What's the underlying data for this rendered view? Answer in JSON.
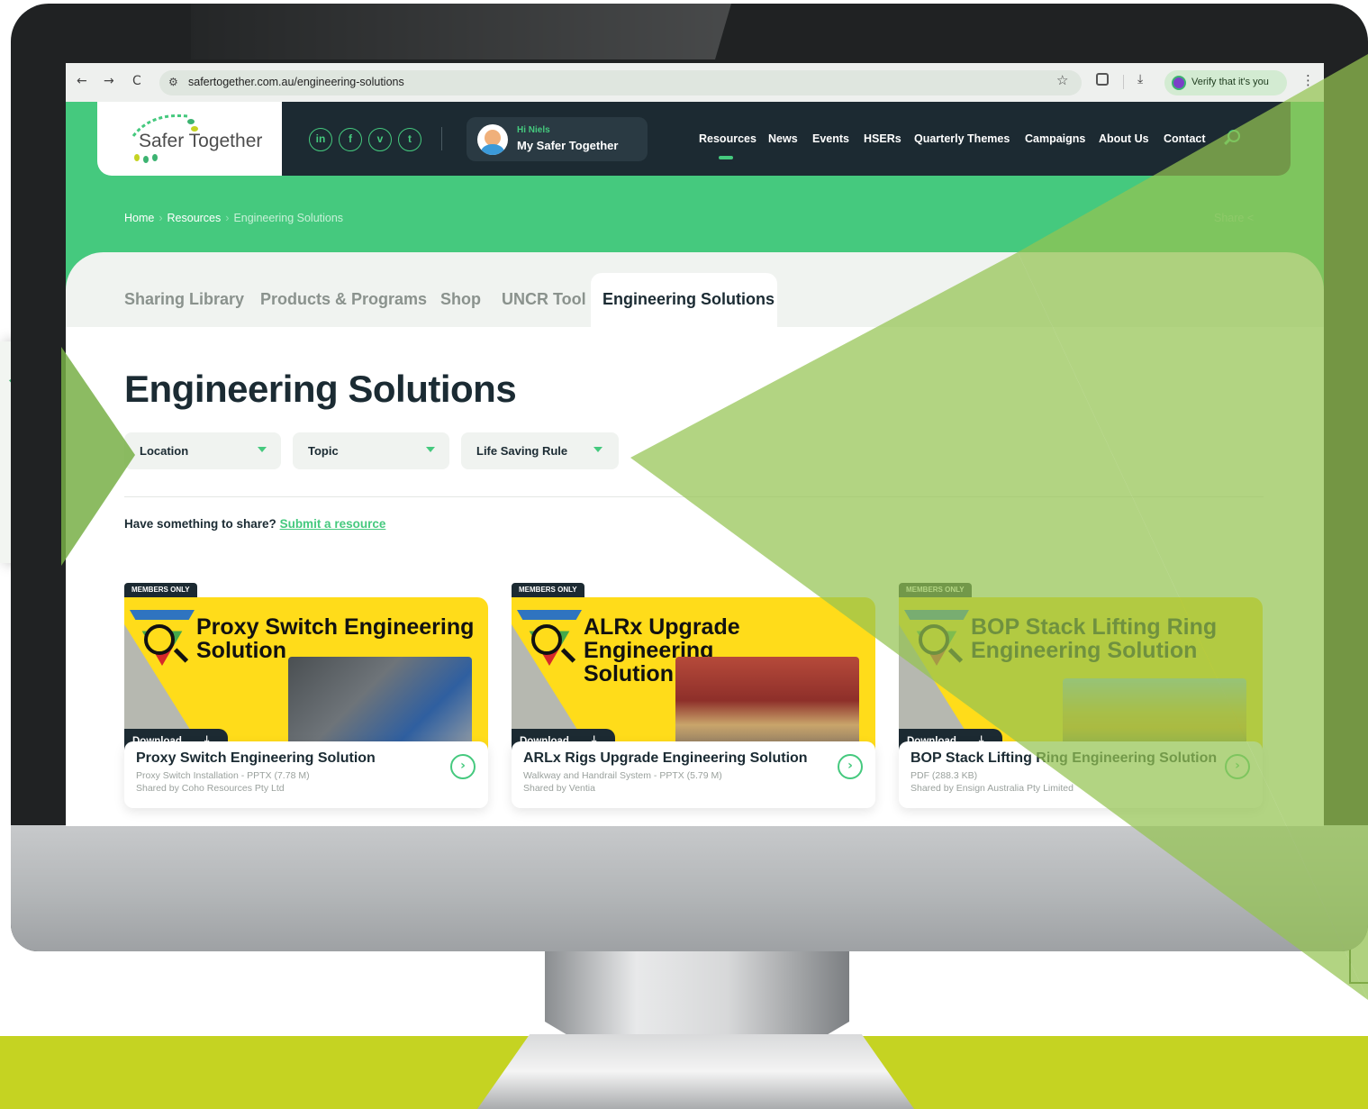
{
  "browser": {
    "nav": {
      "back": "←",
      "forward": "→",
      "reload": "C"
    },
    "url": "safertogether.com.au/engineering-solutions",
    "verify_label": "Verify that it's you",
    "avatar_letter": "N"
  },
  "site": {
    "logo_text": "Safer Together",
    "social": [
      {
        "label": "in",
        "icon": "linkedin-icon"
      },
      {
        "label": "f",
        "icon": "facebook-icon"
      },
      {
        "label": "v",
        "icon": "vimeo-icon"
      },
      {
        "label": "t",
        "icon": "twitter-icon"
      }
    ],
    "user": {
      "greeting": "Hi Niels",
      "name": "My Safer Together"
    },
    "nav": [
      "Resources",
      "News",
      "Events",
      "HSERs",
      "Quarterly Themes",
      "Campaigns",
      "About Us",
      "Contact"
    ],
    "active_nav": "Resources",
    "colors": {
      "brand_green": "#45c97e",
      "navy": "#1c2a32",
      "lime": "#c5d322",
      "card_yellow": "#ffdc1a"
    }
  },
  "breadcrumb": {
    "home": "Home",
    "section": "Resources",
    "current": "Engineering Solutions",
    "separator": "›"
  },
  "share_label": "Share",
  "tabs": [
    {
      "label": "Sharing Library",
      "active": false
    },
    {
      "label": "Products & Programs",
      "active": false
    },
    {
      "label": "Shop",
      "active": false
    },
    {
      "label": "UNCR Tool",
      "active": false
    },
    {
      "label": "Engineering Solutions",
      "active": true
    }
  ],
  "page_title": "Engineering Solutions",
  "filters": [
    {
      "label": "Location"
    },
    {
      "label": "Topic"
    },
    {
      "label": "Life Saving Rule"
    }
  ],
  "share_prompt": "Have something to share?",
  "submit_link": "Submit a resource",
  "cards": [
    {
      "tag": "MEMBERS ONLY",
      "headline_1": "Proxy Switch Engineering",
      "headline_2": "Solution",
      "download_label": "Download",
      "title": "Proxy Switch Engineering Solution",
      "file": "Proxy Switch Installation - PPTX (7.78 M)",
      "shared_by": "Shared by Coho Resources Pty Ltd"
    },
    {
      "tag": "MEMBERS ONLY",
      "headline_1": "ALRx Upgrade Engineering",
      "headline_2": "Solution",
      "download_label": "Download",
      "title": "ARLx Rigs Upgrade Engineering Solution",
      "file": "Walkway and Handrail System - PPTX (5.79 M)",
      "shared_by": "Shared by Ventia"
    },
    {
      "tag": "MEMBERS ONLY",
      "headline_1": "BOP Stack Lifting Ring",
      "headline_2": "Engineering Solution",
      "download_label": "Download",
      "title": "BOP Stack Lifting Ring Engineering Solution",
      "file": "PDF (288.3 KB)",
      "shared_by": "Shared by Ensign Australia Pty Limited"
    }
  ]
}
